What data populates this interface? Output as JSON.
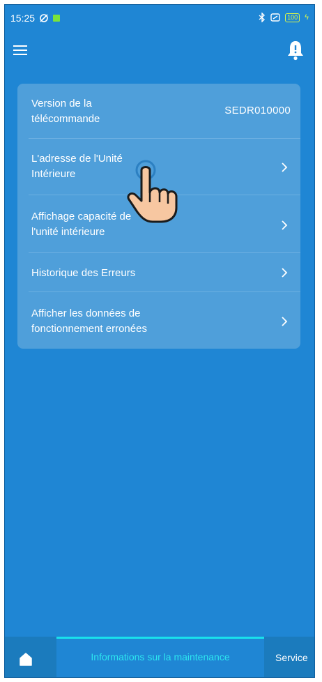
{
  "status_bar": {
    "time": "15:25",
    "battery": "100"
  },
  "settings_card": {
    "rows": [
      {
        "label_line1": "Version de la",
        "label_line2": "télécommande",
        "value": "SEDR010000"
      },
      {
        "label_line1": "L'adresse de l'Unité",
        "label_line2": "Intérieure"
      },
      {
        "label_line1": "Affichage capacité de",
        "label_line2": "l'unité intérieure"
      },
      {
        "label_line1": "Historique des Erreurs"
      },
      {
        "label_line1": "Afficher les données de",
        "label_line2": "fonctionnement erronées"
      }
    ]
  },
  "bottom_nav": {
    "active_tab": "Informations sur la maintenance",
    "next_tab": "Service"
  },
  "icons": {
    "menu": "hamburger-icon",
    "bell": "bell-icon",
    "home": "home-icon",
    "chevron": "chevron-right-icon",
    "bluetooth": "bluetooth-icon",
    "cursor": "hand-pointer-icon"
  },
  "colors": {
    "background": "#1f86d4",
    "card": "#4f9fda",
    "active_tab_text": "#2ce6f0",
    "active_tab_indicator": "#19e0ec"
  }
}
